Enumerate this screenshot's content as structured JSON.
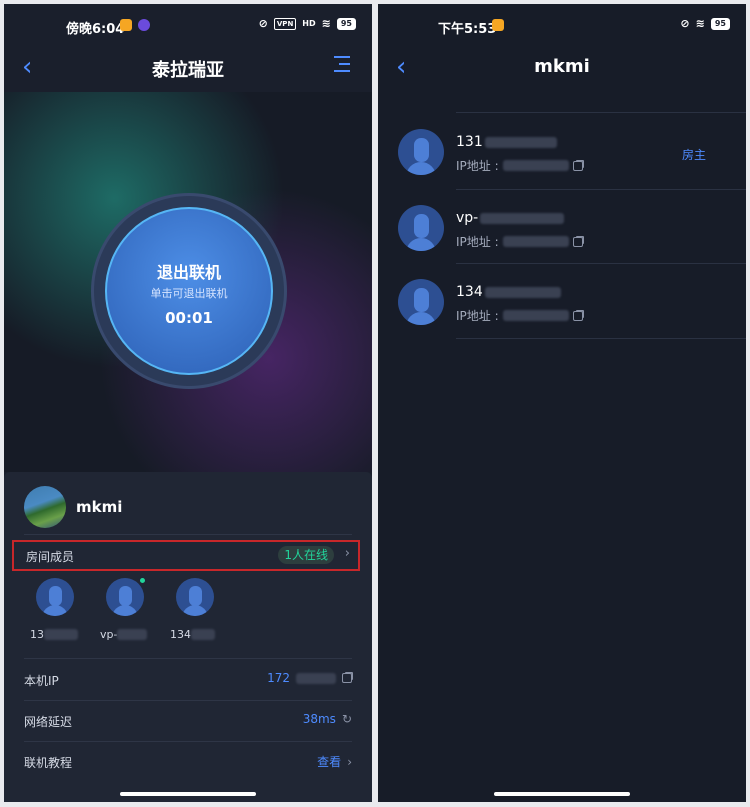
{
  "left": {
    "status": {
      "time": "傍晚6:04",
      "vpn": "VPN",
      "signal": "HD",
      "battery": "95"
    },
    "header": {
      "title": "泰拉瑞亚"
    },
    "exit_button": {
      "title": "退出联机",
      "subtitle": "单击可退出联机",
      "timer": "00:01"
    },
    "user": {
      "name": "mkmi"
    },
    "members": {
      "label": "房间成员",
      "online": "1人在线",
      "items": [
        {
          "name": "13",
          "online": false
        },
        {
          "name": "vp-",
          "online": true
        },
        {
          "name": "134",
          "online": false
        }
      ]
    },
    "rows": [
      {
        "label": "本机IP",
        "value": "172"
      },
      {
        "label": "网络延迟",
        "value": "38ms"
      },
      {
        "label": "联机教程",
        "value": "查看"
      }
    ]
  },
  "right": {
    "status": {
      "time": "下午5:53",
      "battery": "95"
    },
    "header": {
      "title": "mkmi"
    },
    "ip_label": "IP地址 :",
    "members": [
      {
        "name": "131",
        "role": "房主"
      },
      {
        "name": "vp-",
        "role": ""
      },
      {
        "name": "134",
        "role": ""
      }
    ]
  },
  "colors": {
    "accent": "#4e8bff",
    "online": "#22d49b",
    "highlight_border": "#c8272a"
  }
}
